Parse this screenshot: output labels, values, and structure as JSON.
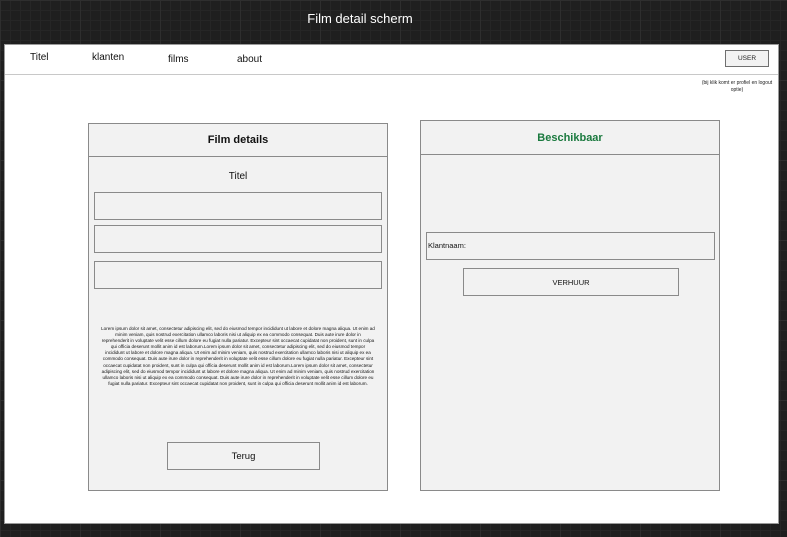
{
  "page": {
    "title": "Film detail scherm"
  },
  "nav": {
    "items": [
      {
        "label": "Titel"
      },
      {
        "label": "klanten"
      },
      {
        "label": "films"
      },
      {
        "label": "about"
      }
    ],
    "user_button": "USER",
    "user_note": "(bij klik komt er profiel en logout optie)"
  },
  "film_details": {
    "header": "Film details",
    "section_title": "Titel",
    "description": "Lorem ipsum dolor sit amet, consectetur adipiscing elit, sed do eiusmod tempor incididunt ut labore et dolore magna aliqua. Ut enim ad minim veniam, quis nostrud exercitation ullamco laboris nisi ut aliquip ex ea commodo consequat. Duis aute irure dolor in reprehenderit in voluptate velit esse cillum dolore eu fugiat nulla pariatur. Excepteur sint occaecat cupidatat non proident, sunt in culpa qui officia deserunt mollit anim id est laborum.Lorem ipsum dolor sit amet, consectetur adipiscing elit, sed do eiusmod tempor incididunt ut labore et dolore magna aliqua. Ut enim ad minim veniam, quis nostrud exercitation ullamco laboris nisi ut aliquip ex ea commodo consequat. Duis aute irure dolor in reprehenderit in voluptate velit esse cillum dolore eu fugiat nulla pariatur. Excepteur sint occaecat cupidatat non proident, sunt in culpa qui officia deserunt mollit anim id est laborum.Lorem ipsum dolor sit amet, consectetur adipiscing elit, sed do eiusmod tempor incididunt ut labore et dolore magna aliqua. Ut enim ad minim veniam, quis nostrud exercitation ullamco laboris nisi ut aliquip ex ea commodo consequat. Duis aute irure dolor in reprehenderit in voluptate velit esse cillum dolore eu fugiat nulla pariatur. Excepteur sint occaecat cupidatat non proident, sunt in culpa qui officia deserunt mollit anim id est laborum.",
    "back_button": "Terug"
  },
  "availability": {
    "header": "Beschikbaar",
    "customer_label": "Klantnaam:",
    "rent_button": "VERHUUR"
  },
  "colors": {
    "available_green": "#1b7a3f"
  }
}
